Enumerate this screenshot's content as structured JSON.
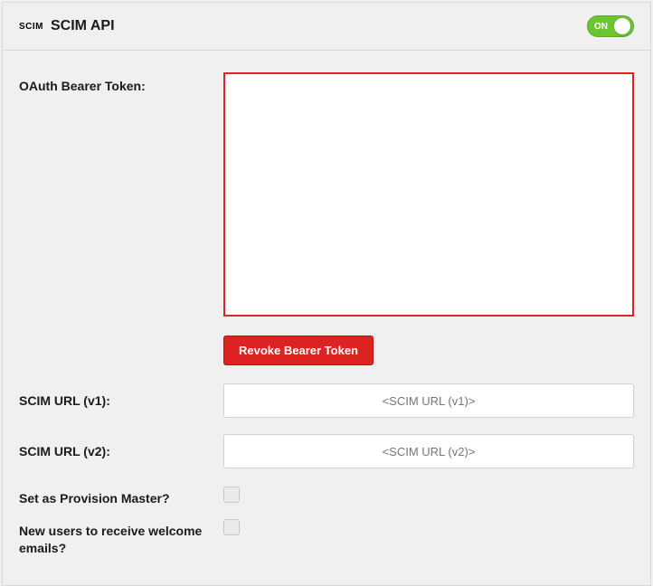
{
  "header": {
    "icon_text": "SCIM",
    "title": "SCIM API",
    "toggle_label": "ON",
    "toggle_state": "on"
  },
  "form": {
    "token_label": "OAuth Bearer Token:",
    "token_value": "",
    "revoke_label": "Revoke Bearer Token",
    "url_v1_label": "SCIM URL (v1):",
    "url_v1_placeholder": "<SCIM URL (v1)>",
    "url_v1_value": "",
    "url_v2_label": "SCIM URL (v2):",
    "url_v2_placeholder": "<SCIM URL (v2)>",
    "url_v2_value": "",
    "provision_master_label": "Set as Provision Master?",
    "provision_master_checked": false,
    "welcome_emails_label": "New users to receive welcome emails?",
    "welcome_emails_checked": false
  },
  "colors": {
    "accent_highlight": "#e22323",
    "button_danger": "#dd2222",
    "toggle_on": "#6bc530"
  }
}
